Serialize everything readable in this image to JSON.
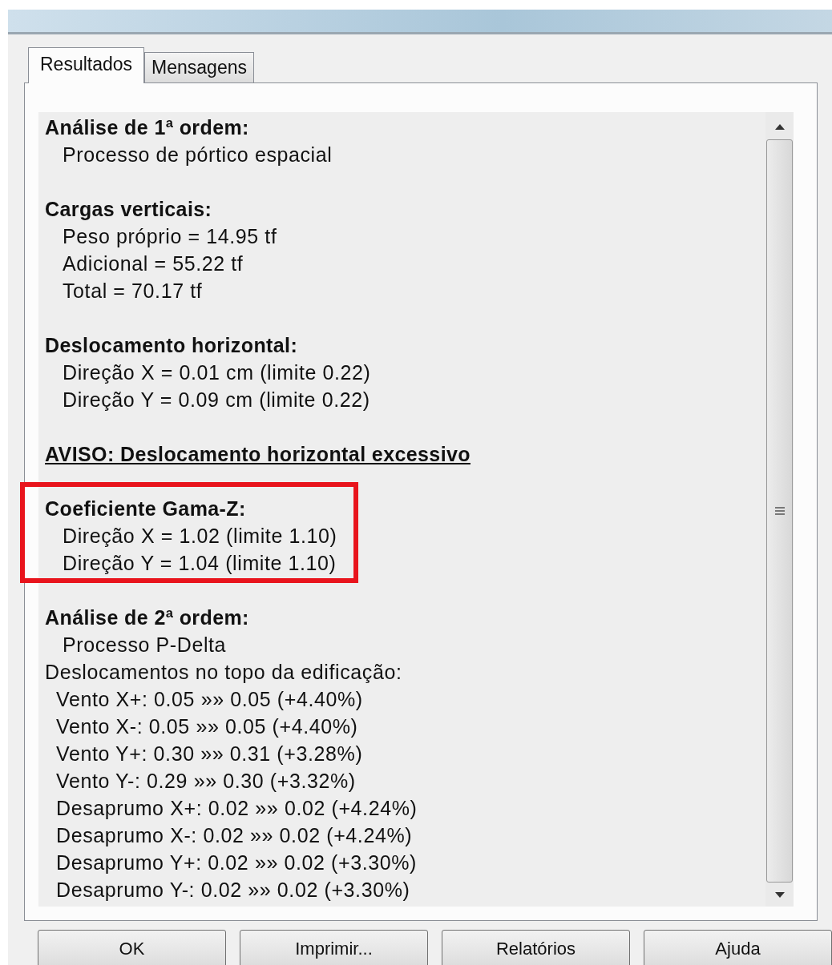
{
  "tabs": [
    {
      "label": "Resultados",
      "selected": true
    },
    {
      "label": "Mensagens",
      "selected": false
    }
  ],
  "sections": [
    {
      "kind": "heading",
      "heading": "Análise de 1ª ordem:",
      "highlighted": false,
      "lines": [
        {
          "kind": "detail",
          "text": "Processo de pórtico espacial"
        }
      ]
    },
    {
      "kind": "heading",
      "heading": "Cargas verticais:",
      "highlighted": false,
      "lines": [
        {
          "kind": "detail",
          "text": "Peso próprio = 14.95 tf"
        },
        {
          "kind": "detail",
          "text": "Adicional = 55.22 tf"
        },
        {
          "kind": "detail",
          "text": "Total = 70.17 tf"
        }
      ]
    },
    {
      "kind": "heading",
      "heading": "Deslocamento horizontal:",
      "highlighted": false,
      "lines": [
        {
          "kind": "detail",
          "text": "Direção X = 0.01 cm (limite 0.22)"
        },
        {
          "kind": "detail",
          "text": "Direção Y = 0.09 cm (limite 0.22)"
        }
      ]
    },
    {
      "kind": "warning",
      "heading": "AVISO: Deslocamento horizontal excessivo",
      "highlighted": false
    },
    {
      "kind": "heading",
      "heading": "Coeficiente Gama-Z:",
      "highlighted": true,
      "lines": [
        {
          "kind": "detail",
          "text": "Direção X = 1.02 (limite 1.10)"
        },
        {
          "kind": "detail",
          "text": "Direção Y = 1.04 (limite 1.10)"
        }
      ]
    },
    {
      "kind": "heading",
      "heading": "Análise de 2ª ordem:",
      "highlighted": false,
      "lines": [
        {
          "kind": "detail",
          "text": "Processo P-Delta"
        },
        {
          "kind": "note",
          "text": "Deslocamentos no topo da edificação:"
        },
        {
          "kind": "item",
          "text": "Vento X+: 0.05 »» 0.05 (+4.40%)"
        },
        {
          "kind": "item",
          "text": "Vento X-: 0.05 »» 0.05 (+4.40%)"
        },
        {
          "kind": "item",
          "text": "Vento Y+: 0.30 »» 0.31 (+3.28%)"
        },
        {
          "kind": "item",
          "text": "Vento Y-: 0.29 »» 0.30 (+3.32%)"
        },
        {
          "kind": "item",
          "text": "Desaprumo X+: 0.02 »» 0.02 (+4.24%)"
        },
        {
          "kind": "item",
          "text": "Desaprumo X-: 0.02 »» 0.02 (+4.24%)"
        },
        {
          "kind": "item",
          "text": "Desaprumo Y+: 0.02 »» 0.02 (+3.30%)"
        },
        {
          "kind": "item",
          "text": "Desaprumo Y-: 0.02 »» 0.02 (+3.30%)"
        }
      ]
    }
  ],
  "buttons": [
    "OK",
    "Imprimir...",
    "Relatórios",
    "Ajuda"
  ]
}
